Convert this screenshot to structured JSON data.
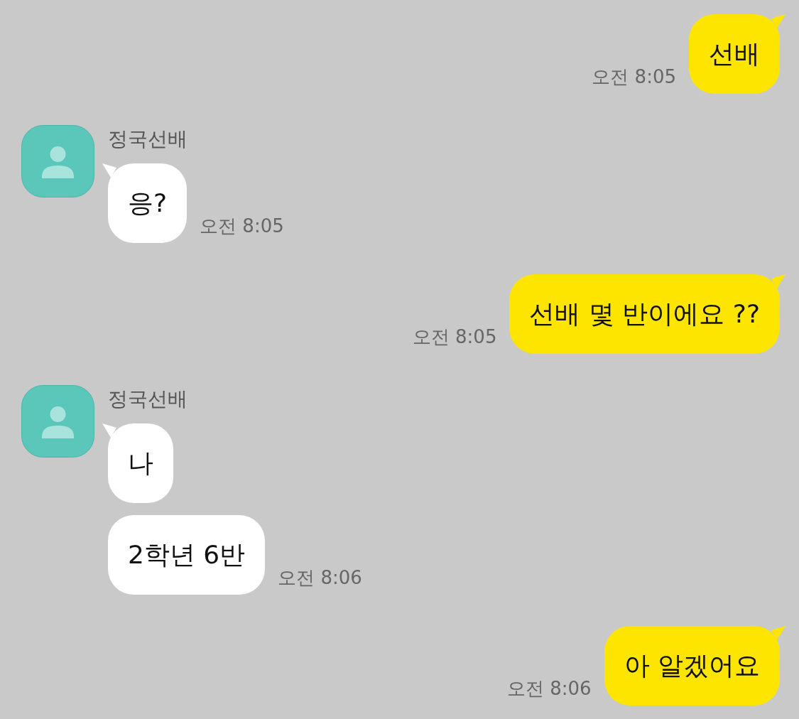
{
  "messages": [
    {
      "kind": "sent",
      "bubbles": [
        "선배"
      ],
      "time": "오전 8:05"
    },
    {
      "kind": "received",
      "name": "정국선배",
      "bubbles": [
        "응?"
      ],
      "time": "오전 8:05"
    },
    {
      "kind": "sent",
      "bubbles": [
        "선배 몇 반이에요 ??"
      ],
      "time": "오전 8:05"
    },
    {
      "kind": "received",
      "name": "정국선배",
      "bubbles": [
        "나",
        "2학년 6반"
      ],
      "time": "오전 8:06"
    },
    {
      "kind": "sent",
      "bubbles": [
        "아 알겠어요"
      ],
      "time": "오전 8:06"
    }
  ]
}
